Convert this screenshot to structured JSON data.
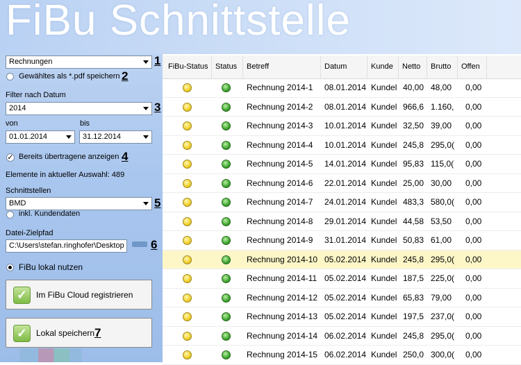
{
  "app": {
    "title": "FiBu Schnittstelle"
  },
  "left": {
    "type_select": {
      "value": "Rechnungen",
      "marker": "1"
    },
    "pdf_check": {
      "label": "Gewähltes als *.pdf speichern",
      "marker": "2"
    },
    "filter": {
      "label": "Filter nach Datum",
      "value": "2014",
      "marker": "3"
    },
    "from": {
      "label": "von",
      "value": "01.01.2014"
    },
    "to": {
      "label": "bis",
      "value": "31.12.2014"
    },
    "show_transferred": {
      "label": "Bereits übertragene anzeigen",
      "marker": "4"
    },
    "count_text": "Elemente in aktueller Auswahl: 489",
    "interfaces": {
      "label": "Schnittstellen",
      "value": "BMD",
      "marker": "5"
    },
    "incl_customers": {
      "label": "inkl. Kundendaten"
    },
    "target_path": {
      "label": "Datei-Zielpfad",
      "value": "C:\\Users\\stefan.ringhofer\\Desktop",
      "marker": "6"
    },
    "fibu_local": {
      "label": "FiBu lokal nutzen"
    },
    "cloud_button": {
      "label": "Im FiBu Cloud registrieren"
    },
    "save_button": {
      "label": "Lokal speichern",
      "marker": "7"
    }
  },
  "table": {
    "columns": [
      "FiBu-Status",
      "Status",
      "Betreff",
      "Datum",
      "Kunde",
      "Netto",
      "Brutto",
      "Offen"
    ],
    "rows": [
      {
        "betreff": "Rechnung 2014-1",
        "datum": "08.01.2014",
        "kunde": "Kundel",
        "netto": "40,00",
        "brutto": "48,00",
        "offen": "0,00"
      },
      {
        "betreff": "Rechnung 2014-2",
        "datum": "08.01.2014",
        "kunde": "Kundel",
        "netto": "966,6",
        "brutto": "1.160,",
        "offen": "0,00"
      },
      {
        "betreff": "Rechnung 2014-3",
        "datum": "10.01.2014",
        "kunde": "Kundel",
        "netto": "32,50",
        "brutto": "39,00",
        "offen": "0,00"
      },
      {
        "betreff": "Rechnung 2014-4",
        "datum": "10.01.2014",
        "kunde": "Kundel",
        "netto": "245,8",
        "brutto": "295,0(",
        "offen": "0,00"
      },
      {
        "betreff": "Rechnung 2014-5",
        "datum": "14.01.2014",
        "kunde": "Kundel",
        "netto": "95,83",
        "brutto": "115,0(",
        "offen": "0,00"
      },
      {
        "betreff": "Rechnung 2014-6",
        "datum": "22.01.2014",
        "kunde": "Kundel",
        "netto": "25,00",
        "brutto": "30,00",
        "offen": "0,00"
      },
      {
        "betreff": "Rechnung 2014-7",
        "datum": "24.01.2014",
        "kunde": "Kundel",
        "netto": "483,3",
        "brutto": "580,0(",
        "offen": "0,00"
      },
      {
        "betreff": "Rechnung 2014-8",
        "datum": "29.01.2014",
        "kunde": "Kundel",
        "netto": "44,58",
        "brutto": "53,50",
        "offen": "0,00"
      },
      {
        "betreff": "Rechnung 2014-9",
        "datum": "31.01.2014",
        "kunde": "Kundel",
        "netto": "50,83",
        "brutto": "61,00",
        "offen": "0,00"
      },
      {
        "betreff": "Rechnung 2014-10",
        "datum": "05.02.2014",
        "kunde": "Kundel",
        "netto": "245,8",
        "brutto": "295,0(",
        "offen": "0,00",
        "selected": true
      },
      {
        "betreff": "Rechnung 2014-11",
        "datum": "05.02.2014",
        "kunde": "Kundel",
        "netto": "187,5",
        "brutto": "225,0(",
        "offen": "0,00"
      },
      {
        "betreff": "Rechnung 2014-12",
        "datum": "05.02.2014",
        "kunde": "Kundel",
        "netto": "65,83",
        "brutto": "79,00",
        "offen": "0,00"
      },
      {
        "betreff": "Rechnung 2014-13",
        "datum": "05.02.2014",
        "kunde": "Kundel",
        "netto": "197,5",
        "brutto": "237,0(",
        "offen": "0,00"
      },
      {
        "betreff": "Rechnung 2014-14",
        "datum": "06.02.2014",
        "kunde": "Kundel",
        "netto": "245,8",
        "brutto": "295,0(",
        "offen": "0,00"
      },
      {
        "betreff": "Rechnung 2014-15",
        "datum": "06.02.2014",
        "kunde": "Kundel",
        "netto": "250,0",
        "brutto": "300,0(",
        "offen": "0,00"
      }
    ]
  }
}
